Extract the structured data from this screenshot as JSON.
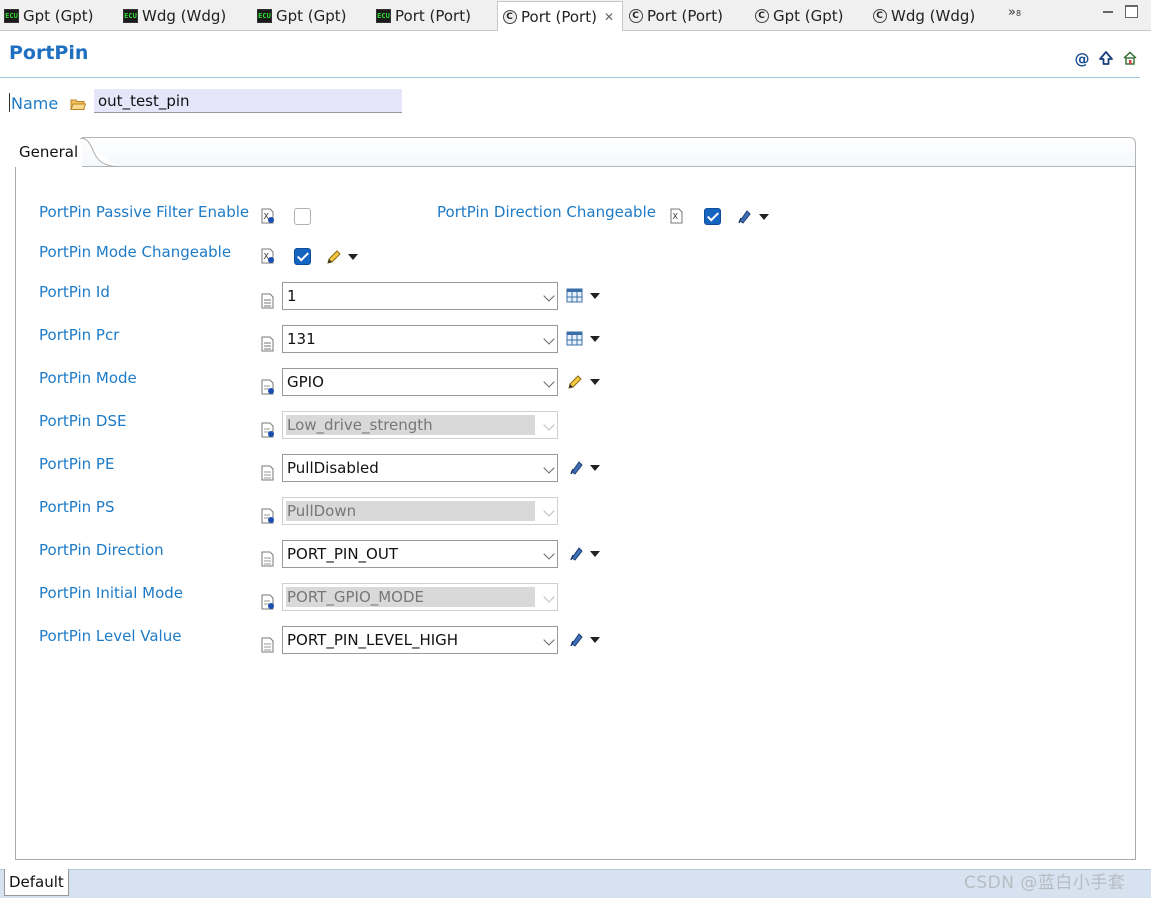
{
  "tabs": [
    {
      "label": "Gpt (Gpt)",
      "icon": "ecu-icon",
      "active": false
    },
    {
      "label": "Wdg (Wdg)",
      "icon": "ecu-icon",
      "active": false
    },
    {
      "label": "Gpt (Gpt)",
      "icon": "ecu-icon",
      "active": false
    },
    {
      "label": "Port (Port)",
      "icon": "ecu-icon",
      "active": false
    },
    {
      "label": "Port (Port)",
      "icon": "c-module-icon",
      "active": true
    },
    {
      "label": "Port (Port)",
      "icon": "c-module-icon",
      "active": false
    },
    {
      "label": "Gpt (Gpt)",
      "icon": "c-module-icon",
      "active": false
    },
    {
      "label": "Wdg (Wdg)",
      "icon": "c-module-icon",
      "active": false
    }
  ],
  "overflow": {
    "label": "»",
    "count": "8"
  },
  "ecu_icon_text": "ECU",
  "c_icon_text": "C",
  "editor": {
    "title": "PortPin",
    "name_label": "Name",
    "name_value": "out_test_pin",
    "group_tab": "General",
    "bottom_tab": "Default"
  },
  "fields": {
    "passive_filter": {
      "label": "PortPin Passive Filter Enable",
      "checked": false
    },
    "direction_changeable": {
      "label": "PortPin Direction Changeable",
      "checked": true
    },
    "mode_changeable": {
      "label": "PortPin Mode Changeable",
      "checked": true
    },
    "id": {
      "label": "PortPin Id",
      "value": "1"
    },
    "pcr": {
      "label": "PortPin Pcr",
      "value": "131"
    },
    "mode": {
      "label": "PortPin Mode",
      "value": "GPIO"
    },
    "dse": {
      "label": "PortPin DSE",
      "value": "Low_drive_strength",
      "disabled": true
    },
    "pe": {
      "label": "PortPin PE",
      "value": "PullDisabled"
    },
    "ps": {
      "label": "PortPin PS",
      "value": "PullDown",
      "disabled": true
    },
    "direction": {
      "label": "PortPin Direction",
      "value": "PORT_PIN_OUT"
    },
    "initial_mode": {
      "label": "PortPin Initial Mode",
      "value": "PORT_GPIO_MODE",
      "disabled": true
    },
    "level_value": {
      "label": "PortPin Level Value",
      "value": "PORT_PIN_LEVEL_HIGH"
    }
  },
  "watermark": "CSDN @蓝白小手套",
  "colors": {
    "label_blue": "#1e7bc7",
    "title_blue": "#1e6fc0",
    "check_blue": "#1565c0",
    "name_bg": "#e6e6fb"
  }
}
